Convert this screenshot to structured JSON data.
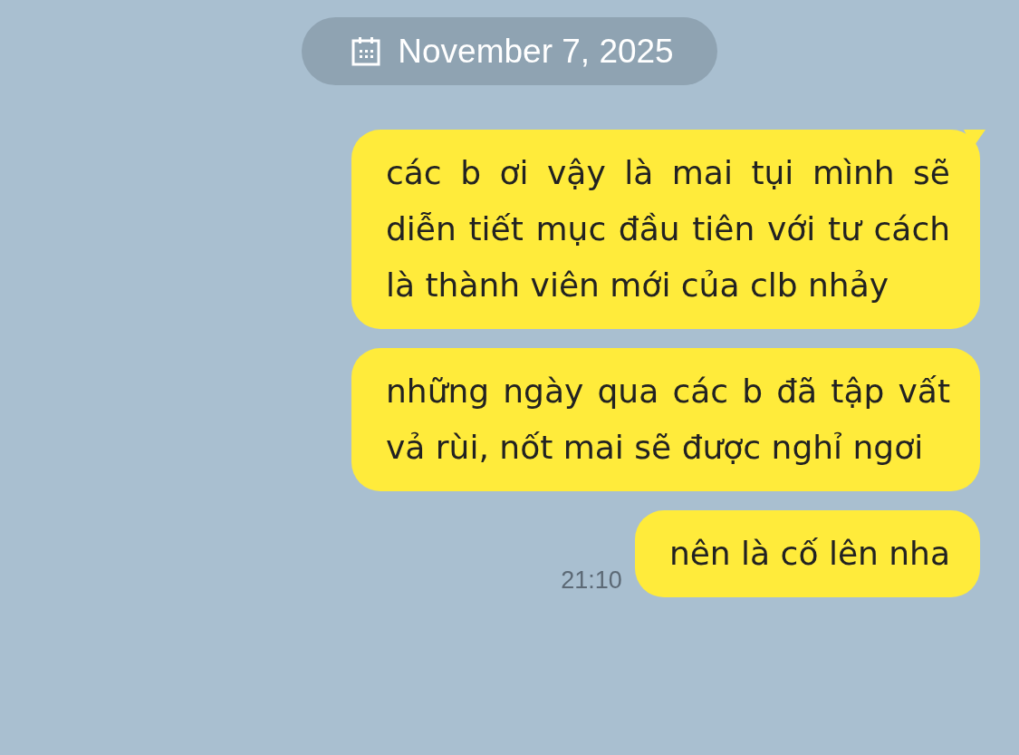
{
  "date_chip": {
    "label": "November 7, 2025"
  },
  "messages": [
    {
      "text": "các b ơi vậy là mai tụi mình sẽ diễn tiết mục đầu tiên với tư cách là thành viên mới của clb nhảy",
      "tail": true
    },
    {
      "text": "những ngày qua các b đã tập vất vả rùi, nốt mai sẽ được nghỉ ngơi",
      "tail": false
    },
    {
      "text": "nên là cố lên nha",
      "tail": false,
      "time": "21:10"
    }
  ]
}
